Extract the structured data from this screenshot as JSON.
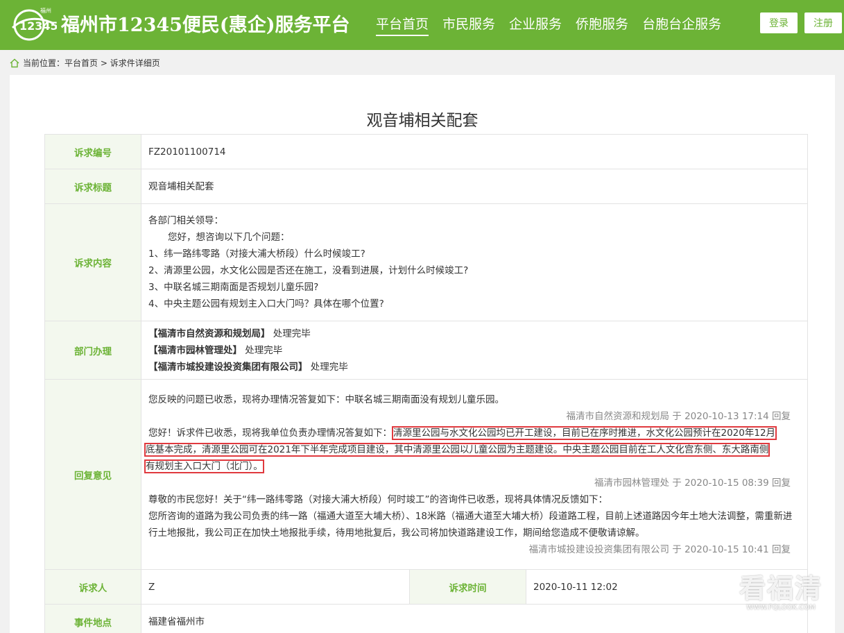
{
  "header": {
    "logo_text": "福州",
    "site_title": "福州市12345便民(惠企)服务平台",
    "nav": [
      "平台首页",
      "市民服务",
      "企业服务",
      "侨胞服务",
      "台胞台企服务"
    ],
    "login_label": "登录",
    "register_label": "注册",
    "bg_color": "#6cb336"
  },
  "breadcrumb": {
    "prefix": "当前位置：",
    "home": "平台首页",
    "separator": " > ",
    "current": "诉求件详细页"
  },
  "page_title": "观音埔相关配套",
  "fields": {
    "id_label": "诉求编号",
    "id_value": "FZ20101100714",
    "title_label": "诉求标题",
    "title_value": "观音埔相关配套",
    "content_label": "诉求内容",
    "content_lines": [
      "各部门相关领导：",
      "您好，想咨询以下几个问题：",
      "1、纬一路纬零路（对接大浦大桥段）什么时候竣工?",
      "2、清源里公园，水文化公园是否还在施工，没看到进展，计划什么时候竣工?",
      "3、中联名城三期南面是否规划儿童乐园?",
      "4、中央主题公园有规划主入口大门吗？具体在哪个位置?"
    ],
    "dept_label": "部门办理",
    "depts": [
      {
        "name": "【福清市自然资源和规划局】",
        "status": "处理完毕"
      },
      {
        "name": "【福清市园林管理处】",
        "status": "处理完毕"
      },
      {
        "name": "【福清市城投建设投资集团有限公司】",
        "status": "处理完毕"
      }
    ],
    "reply_label": "回复意见",
    "replies": [
      {
        "text": "您反映的问题已收悉，现将办理情况答复如下：中联名城三期南面没有规划儿童乐园。",
        "signature": "福清市自然资源和规划局 于 2020-10-13 17:14 回复"
      },
      {
        "text_prefix": "您好！诉求件已收悉，现将我单位负责办理情况答复如下：",
        "text_highlight_1": "清源里公园与水文化公园均已开工建设，目前已在序时推进，水文化公园预计在2020年12月",
        "text_highlight_2": "底基本完成，清源里公园可在2021年下半年完成项目建设，其中清源里公园以儿童公园为主题建设。中央主题公园目前在工人文化宫东侧、东大路南侧",
        "text_highlight_3": "有规划主入口大门（北门）。",
        "signature": "福清市园林管理处 于 2020-10-15 08:39 回复"
      },
      {
        "text_line_1": "尊敬的市民您好！关于“纬一路纬零路（对接大浦大桥段）何时竣工”的咨询件已收悉，现将具体情况反馈如下：",
        "text_line_2": "您所咨询的道路为我公司负责的纬一路（福通大道至大埔大桥）、18米路（福通大道至大埔大桥）段道路工程，目前上述道路因今年土地大法调整，需重新进行土地报批，我公司正在加快土地报批手续，待用地批复后，我公司将加快道路建设工作，期间给您造成不便敬请谅解。",
        "signature": "福清市城投建设投资集团有限公司 于 2020-10-15 10:41 回复"
      }
    ],
    "petitioner_label": "诉求人",
    "petitioner_value": "Z",
    "time_label": "诉求时间",
    "time_value": "2020-10-11 12:02",
    "location_label": "事件地点",
    "location_value": "福建省福州市"
  },
  "watermark": {
    "text": "看福清",
    "url": "WWW.FQLOOK.COM"
  }
}
